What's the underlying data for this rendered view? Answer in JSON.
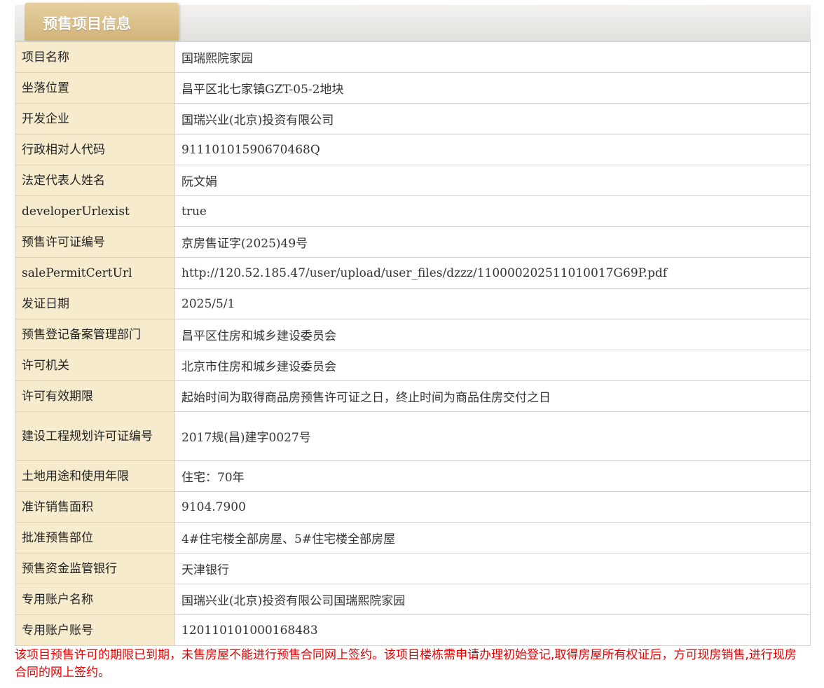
{
  "tab": {
    "title": "预售项目信息"
  },
  "rows": [
    {
      "label": "项目名称",
      "value": "国瑞熙院家园"
    },
    {
      "label": "坐落位置",
      "value": "昌平区北七家镇GZT-05-2地块"
    },
    {
      "label": "开发企业",
      "value": "国瑞兴业(北京)投资有限公司"
    },
    {
      "label": "行政相对人代码",
      "value": "91110101590670468Q"
    },
    {
      "label": "法定代表人姓名",
      "value": "阮文娟"
    },
    {
      "label": "developerUrlexist",
      "value": "true"
    },
    {
      "label": "预售许可证编号",
      "value": "京房售证字(2025)49号"
    },
    {
      "label": "salePermitCertUrl",
      "value": "http://120.52.185.47/user/upload/user_files/dzzz/110000202511010017G69P.pdf"
    },
    {
      "label": "发证日期",
      "value": "2025/5/1"
    },
    {
      "label": "预售登记备案管理部门",
      "value": "昌平区住房和城乡建设委员会"
    },
    {
      "label": "许可机关",
      "value": "北京市住房和城乡建设委员会"
    },
    {
      "label": "许可有效期限",
      "value": "起始时间为取得商品房预售许可证之日，终止时间为商品住房交付之日"
    },
    {
      "label": "建设工程规划许可证编号",
      "value": "2017规(昌)建字0027号"
    },
    {
      "label": "土地用途和使用年限",
      "value": "住宅：70年"
    },
    {
      "label": "准许销售面积",
      "value": "9104.7900"
    },
    {
      "label": "批准预售部位",
      "value": "4#住宅楼全部房屋、5#住宅楼全部房屋"
    },
    {
      "label": "预售资金监管银行",
      "value": "天津银行"
    },
    {
      "label": "专用账户名称",
      "value": "国瑞兴业(北京)投资有限公司国瑞熙院家园"
    },
    {
      "label": "专用账户账号",
      "value": "120110101000168483"
    }
  ],
  "notice": "该项目预售许可的期限已到期，未售房屋不能进行预售合同网上签约。该项目楼栋需申请办理初始登记,取得房屋所有权证后，方可现房销售,进行现房合同的网上签约。"
}
